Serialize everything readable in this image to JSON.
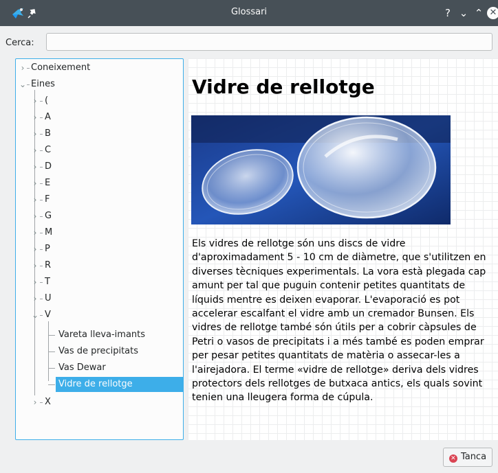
{
  "window": {
    "title": "Glossari",
    "help_glyph": "?",
    "minimize_glyph": "⌄",
    "maximize_glyph": "⌃",
    "close_glyph": "✕"
  },
  "search": {
    "label": "Cerca:",
    "value": "",
    "placeholder": ""
  },
  "tree": {
    "items": [
      {
        "label": "Coneixement",
        "expanded": false
      },
      {
        "label": "Eines",
        "expanded": true
      },
      {
        "label": "(",
        "expanded": false
      },
      {
        "label": "A",
        "expanded": false
      },
      {
        "label": "B",
        "expanded": false
      },
      {
        "label": "C",
        "expanded": false
      },
      {
        "label": "D",
        "expanded": false
      },
      {
        "label": "E",
        "expanded": false
      },
      {
        "label": "F",
        "expanded": false
      },
      {
        "label": "G",
        "expanded": false
      },
      {
        "label": "M",
        "expanded": false
      },
      {
        "label": "P",
        "expanded": false
      },
      {
        "label": "R",
        "expanded": false
      },
      {
        "label": "T",
        "expanded": false
      },
      {
        "label": "U",
        "expanded": false
      },
      {
        "label": "V",
        "expanded": true
      },
      {
        "label": "Vareta lleva-imants"
      },
      {
        "label": "Vas de precipitats"
      },
      {
        "label": "Vas Dewar"
      },
      {
        "label": "Vidre de rellotge",
        "selected": true
      },
      {
        "label": "X",
        "expanded": false
      }
    ]
  },
  "article": {
    "title": "Vidre de rellotge",
    "body": "Els vidres de rellotge són uns discs de vidre d'aproximadament 5 - 10 cm de diàmetre, que s'utilitzen en diverses tècniques experimentals. La vora està plegada cap amunt per tal que puguin contenir petites quantitats de líquids mentre es deixen evaporar. L'evaporació es pot accelerar escalfant el vidre amb un cremador Bunsen. Els vidres de rellotge també són útils per a cobrir càpsules de Petri o vasos de precipitats i a més també es poden emprar per pesar petites quantitats de matèria o assecar-les a l'airejadora. El terme «vidre de rellotge» deriva dels vidres protectors dels rellotges de butxaca antics, els quals sovint tenien una lleugera forma de cúpula."
  },
  "buttons": {
    "close_label": "Tanca"
  },
  "colors": {
    "titlebar": "#475057",
    "accent": "#3daee9",
    "window_bg": "#eff0f1",
    "close_icon": "#da4453"
  }
}
